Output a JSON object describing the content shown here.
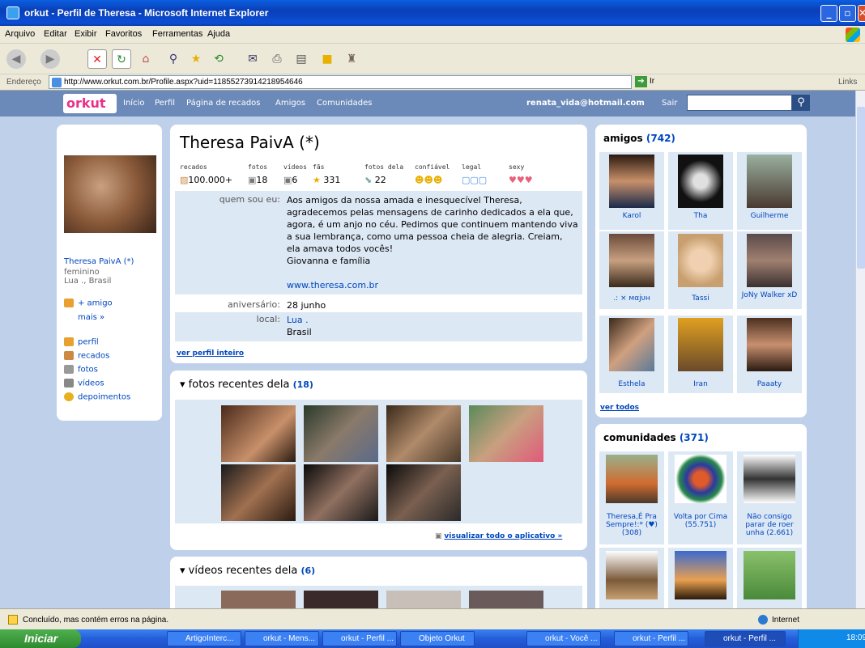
{
  "window": {
    "title": "orkut - Perfil de Theresa - Microsoft Internet Explorer"
  },
  "menu": [
    "Arquivo",
    "Editar",
    "Exibir",
    "Favoritos",
    "Ferramentas",
    "Ajuda"
  ],
  "address": {
    "label": "Endereço",
    "url": "http://www.orkut.com.br/Profile.aspx?uid=11855273914218954646",
    "go": "Ir",
    "links": "Links"
  },
  "orkut": {
    "logo": "orkut",
    "nav": [
      "Início",
      "Perfil",
      "Página de recados",
      "Amigos",
      "Comunidades"
    ],
    "email": "renata_vida@hotmail.com",
    "sair": "Sair"
  },
  "left": {
    "name": "Theresa PaivA (*)",
    "gender": "feminino",
    "location": "Lua ., Brasil",
    "add_friend": "+ amigo",
    "more": "mais »",
    "links": [
      "perfil",
      "recados",
      "fotos",
      "vídeos",
      "depoimentos"
    ]
  },
  "profile": {
    "name": "Theresa PaivA (*)",
    "stats": [
      {
        "label": "recados",
        "value": "100.000+"
      },
      {
        "label": "fotos",
        "value": "18"
      },
      {
        "label": "vídeos",
        "value": "6"
      },
      {
        "label": "fãs",
        "value": "331"
      },
      {
        "label": "fotos dela",
        "value": "22"
      },
      {
        "label": "confiável",
        "value": ""
      },
      {
        "label": "legal",
        "value": ""
      },
      {
        "label": "sexy",
        "value": ""
      }
    ],
    "about_label": "quem sou eu:",
    "about_text": "Aos amigos da nossa amada e inesquecível Theresa, agradecemos pelas mensagens de carinho dedicados a ela que, agora, é um anjo no céu. Pedimos que continuem mantendo viva a sua lembrança, como uma pessoa cheia de alegria. Creiam, ela amava todos vocês!",
    "about_sign": "Giovanna e família",
    "website": "www.theresa.com.br",
    "birthday_label": "aniversário:",
    "birthday": "28 junho",
    "local_label": "local:",
    "local_city": "Lua .",
    "local_country": "Brasil",
    "full_profile": "ver perfil inteiro"
  },
  "photos": {
    "title": "fotos recentes dela",
    "count": "(18)",
    "view_app": "visualizar todo o aplicativo »"
  },
  "videos": {
    "title": "vídeos recentes dela",
    "count": "(6)"
  },
  "friends": {
    "title": "amigos",
    "count": "(742)",
    "names": [
      "Karol",
      "Tha",
      "Guilherme",
      ".: × мαjυн",
      "Tassi",
      "JoNy Walker xD",
      "Esthela",
      "Iran",
      "Paaaty"
    ],
    "see_all": "ver todos"
  },
  "communities": {
    "title": "comunidades",
    "count": "(371)",
    "names": [
      "Theresa,É Pra Sempre!:* (♥) (308)",
      "Volta por Cima (55.751)",
      "Não consigo parar de roer unha (2.661)"
    ]
  },
  "status": {
    "text": "Concluído, mas contém erros na página.",
    "zone": "Internet"
  },
  "taskbar": {
    "start": "Iniciar",
    "tasks": [
      "ArtigoInterc...",
      "orkut - Mens...",
      "orkut - Perfil ...",
      "Objeto Orkut",
      "orkut - Você ...",
      "orkut - Perfil ...",
      "orkut - Perfil ..."
    ],
    "clock": "18:09"
  }
}
